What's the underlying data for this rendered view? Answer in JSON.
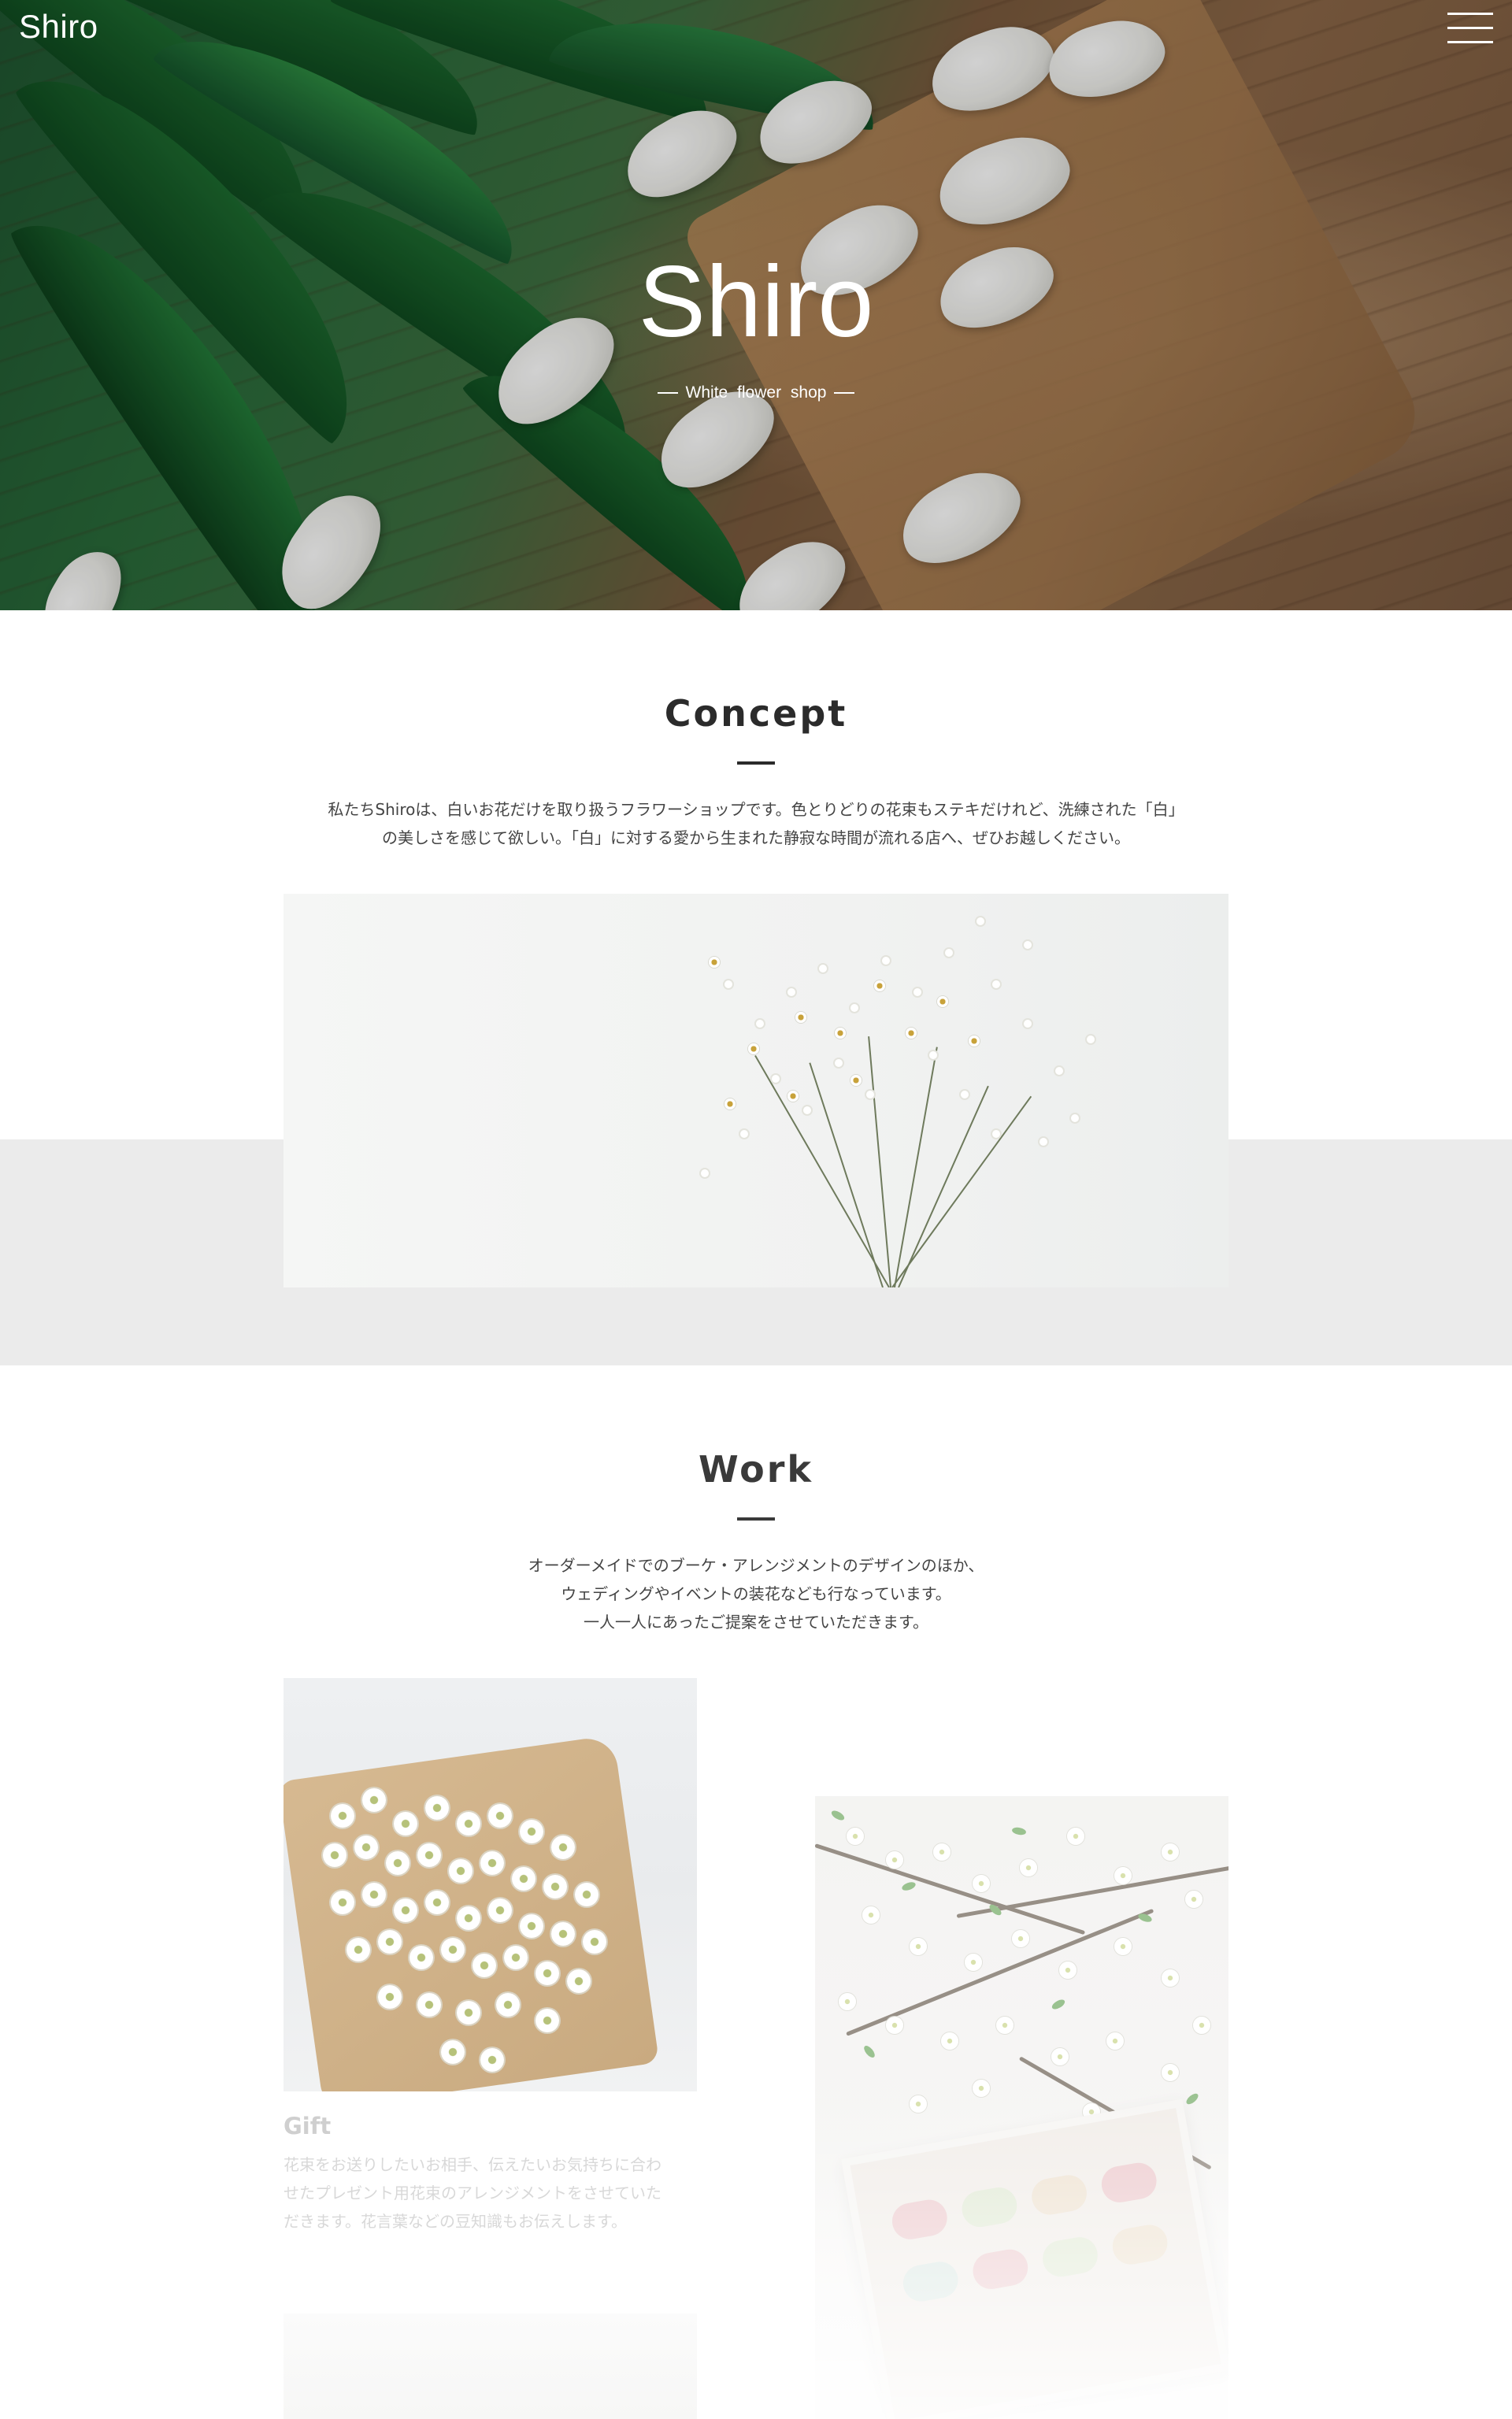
{
  "header": {
    "logo": "Shiro",
    "menu_icon": "hamburger-menu-icon"
  },
  "hero": {
    "title": "Shiro",
    "subtitle": "White flower shop",
    "image": "white tulips bouquet on wooden table"
  },
  "concept": {
    "title": "Concept",
    "text_lines": [
      "私たちShiroは、白いお花だけを取り扱うフラワーショップです。色とりどりの花束もステキだけれど、洗練された「白」",
      "の美しさを感じて欲しい。「白」に対する愛から生まれた静寂な時間が流れる店へ、ぜひお越しください。"
    ],
    "image": "white baby's breath and chamomile bouquet"
  },
  "work": {
    "title": "Work",
    "text_lines": [
      "オーダーメイドでのブーケ・アレンジメントのデザインのほか、",
      "ウェディングやイベントの装花なども行なっています。",
      "一人一人にあったご提案をさせていただきます。"
    ],
    "items": [
      {
        "title": "Gift",
        "text_lines": [
          "花束をお送りしたいお相手、伝えたいお気持ちに合わ",
          "せたプレゼント用花束のアレンジメントをさせていた",
          "だきます。花言葉などの豆知識もお伝えします。"
        ],
        "image": "white chrysanthemum bouquet in kraft paper"
      },
      {
        "image": "white blossom branches with macaron gift box"
      },
      {
        "image": "white flowers"
      }
    ]
  },
  "colors": {
    "text": "#333333",
    "heading": "#2b2b2b",
    "band": "#ebebeb",
    "faded_text": "#d8d8d8"
  }
}
